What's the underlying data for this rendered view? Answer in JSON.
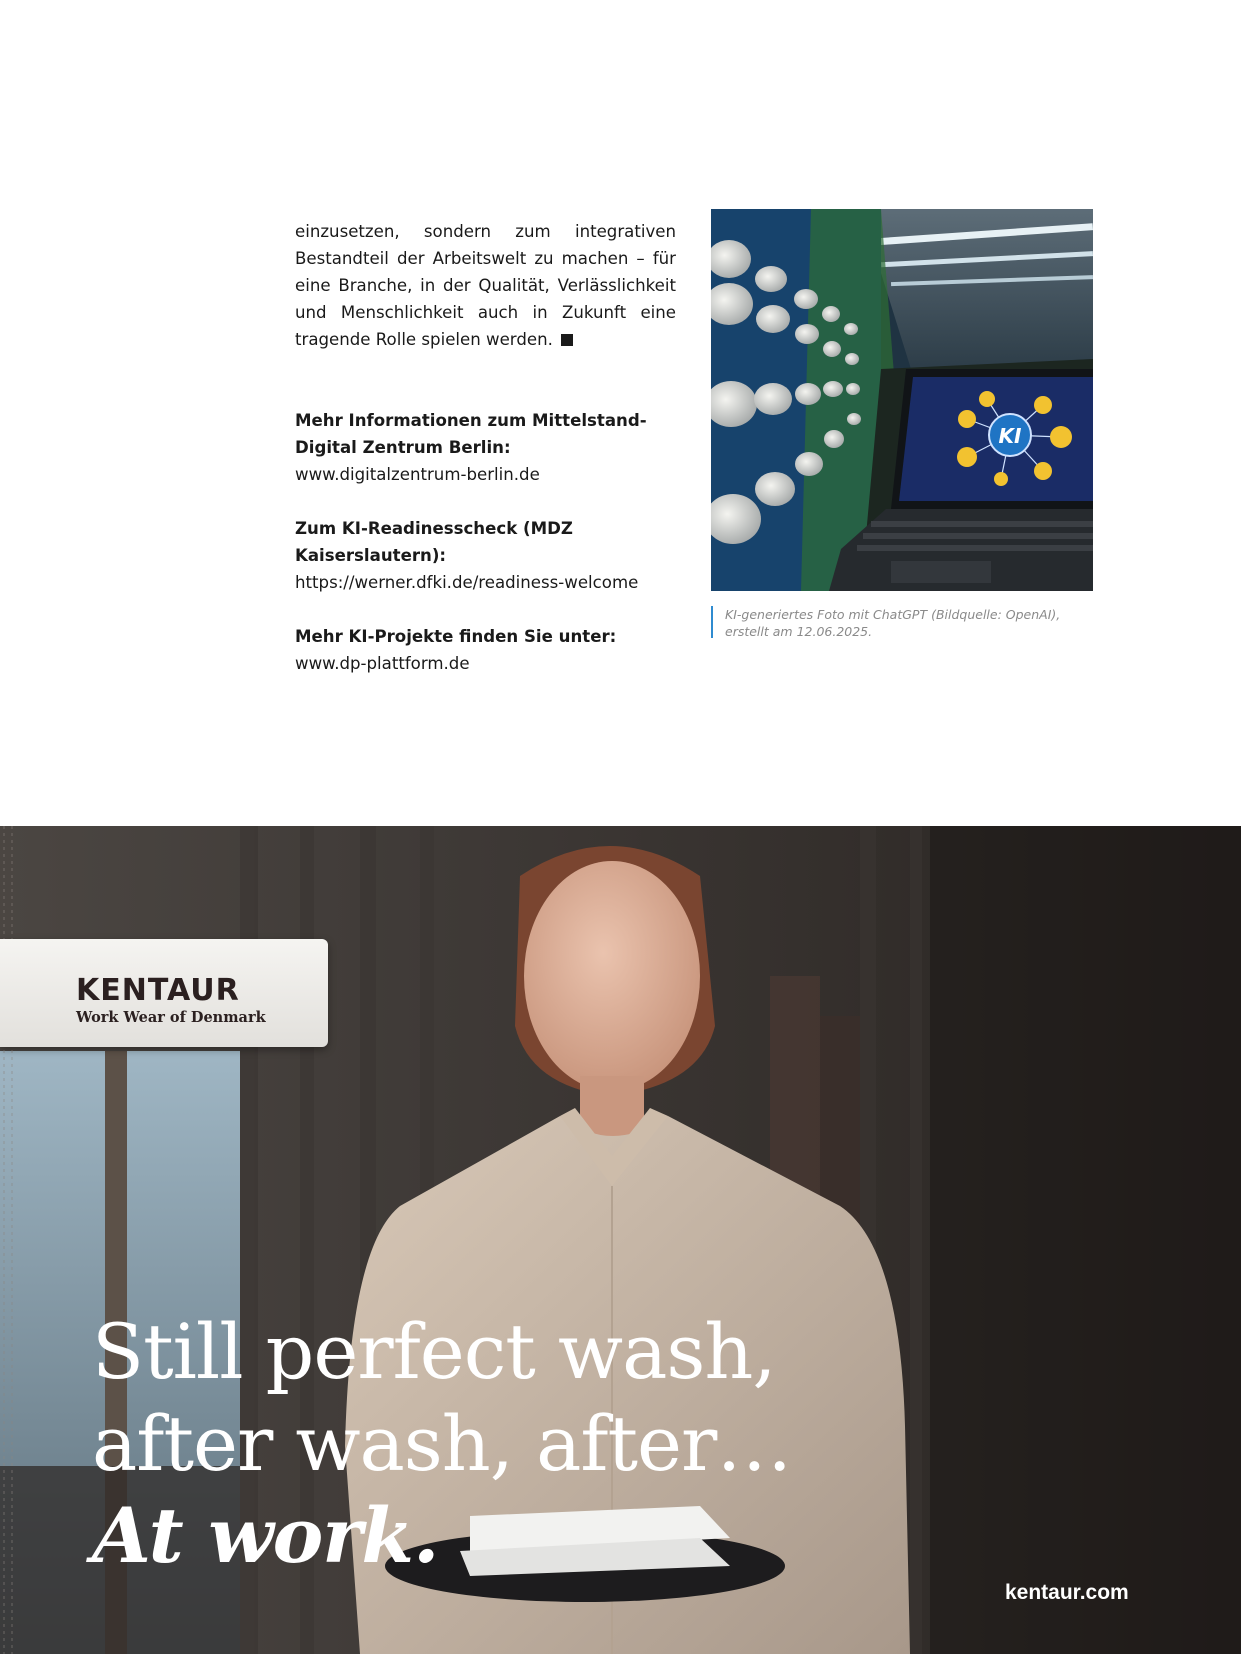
{
  "article": {
    "body_paragraph": "einzusetzen, sondern zum integrativen Bestandteil der Arbeitswelt zu machen – für eine Branche, in der Qualität, Verlässlichkeit und Menschlichkeit auch in Zukunft eine tragende Rolle spielen werden.",
    "info": [
      {
        "heading": "Mehr Informationen zum Mittelstand-Digital Zentrum Berlin:",
        "link": "www.digitalzentrum-berlin.de"
      },
      {
        "heading": "Zum KI-Readinesscheck (MDZ Kaiserslautern):",
        "link": "https://werner.dfki.de/readiness-welcome"
      },
      {
        "heading": "Mehr KI-Projekte finden Sie unter:",
        "link": "www.dp-plattform.de"
      }
    ]
  },
  "photo": {
    "screen_label": "KI",
    "caption": "KI-generiertes Foto mit ChatGPT (Bildquelle: OpenAI), erstellt am 12.06.2025."
  },
  "ad": {
    "brand_name": "KENTAUR",
    "brand_tagline": "Work Wear of Denmark",
    "headline_line1": "Still perfect wash,",
    "headline_line2": "after wash, after…",
    "headline_line3": "At work.",
    "url": "kentaur.com"
  },
  "colors": {
    "caption_rule": "#2f8bd0",
    "ki_node": "#f2c230",
    "ki_hub": "#1f74c4"
  }
}
